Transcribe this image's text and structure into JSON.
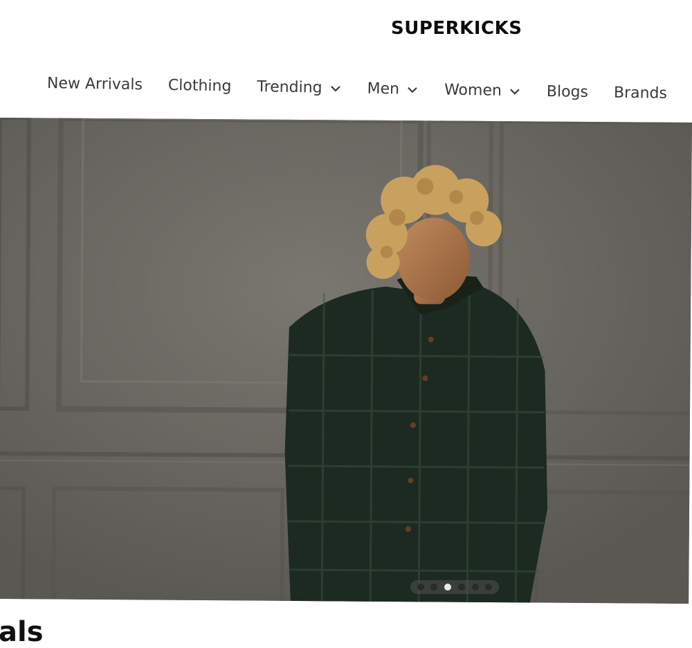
{
  "brand": {
    "logo_text": "SUPERKICKS"
  },
  "nav": {
    "items": [
      {
        "label": "New Arrivals",
        "has_dropdown": false
      },
      {
        "label": "Clothing",
        "has_dropdown": false
      },
      {
        "label": "Trending",
        "has_dropdown": true
      },
      {
        "label": "Men",
        "has_dropdown": true
      },
      {
        "label": "Women",
        "has_dropdown": true
      },
      {
        "label": "Blogs",
        "has_dropdown": false
      },
      {
        "label": "Brands",
        "has_dropdown": false
      }
    ],
    "dropdown_icon": "chevron-down-icon"
  },
  "hero": {
    "slide_count": 6,
    "active_slide": 3,
    "image_subject": "hero-model-photo"
  },
  "section": {
    "title_visible": "als"
  },
  "colors": {
    "logo": "#0c0c0c",
    "nav_text": "#3a3a3a",
    "hero_wall": "#6b6964",
    "dot_active": "#e9e9e9",
    "dot_inactive": "#2a2a2a"
  }
}
